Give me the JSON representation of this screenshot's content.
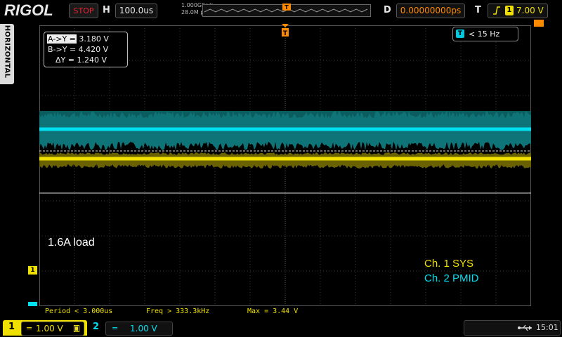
{
  "header": {
    "brand": "RIGOL",
    "run_state": "STOP",
    "timebase_label": "H",
    "timebase_value": "100.0us",
    "sample_rate": "1.000GSa/s",
    "memory_depth": "28.0M pts",
    "delay_label": "D",
    "delay_value": "0.00000000ps",
    "trigger_label": "T",
    "trigger_source": "1",
    "trigger_level": "7.00 V"
  },
  "side_tab": {
    "label": "HORIZONTAL"
  },
  "cursor_readout": {
    "a_y": "3.180 V",
    "b_y": "4.420 V",
    "delta_y": "1.240 V",
    "a_y_label": "A->Y =",
    "b_y_label": "B->Y =",
    "delta_y_label": "ΔY ="
  },
  "freq_counter": {
    "icon_letter": "T",
    "value": "< 15 Hz"
  },
  "annotations": {
    "load": "1.6A load",
    "ch1_name": "Ch. 1 SYS",
    "ch2_name": "Ch. 2 PMID"
  },
  "measurements": {
    "period": "Period < 3.000us",
    "freq": "Freq > 333.3kHz",
    "max": "Max = 3.44 V"
  },
  "channels": [
    {
      "num": "1",
      "coupling": "=",
      "scale": "1.00 V",
      "color": "#f0e000"
    },
    {
      "num": "2",
      "coupling": "=",
      "scale": "1.00 V",
      "color": "#00e0f0"
    }
  ],
  "markers": {
    "ch1": "1",
    "ch2": "2"
  },
  "status": {
    "time": "15:01"
  },
  "colors": {
    "ch1": "#f0e000",
    "ch2": "#00e0f0",
    "ch2_noise": "#0b5c5e",
    "ch1_noise": "#6a6200",
    "grid": "#3a3a3a",
    "trigger": "#ff8a00"
  }
}
